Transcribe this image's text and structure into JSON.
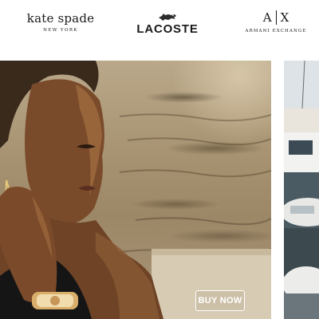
{
  "brands": {
    "kate_spade": {
      "name": "kate spade",
      "location": "NEW YORK"
    },
    "lacoste": {
      "name": "LACOSTE",
      "icon": "crocodile-icon"
    },
    "armani_exchange": {
      "mono_left": "A",
      "mono_right": "X",
      "name": "ARMANI EXCHANGE"
    }
  },
  "hero": {
    "cta_label": "BUY NOW"
  },
  "colors": {
    "cta_border": "#ffffff",
    "background": "#ffffff",
    "brand_text": "#1a1a1a"
  }
}
